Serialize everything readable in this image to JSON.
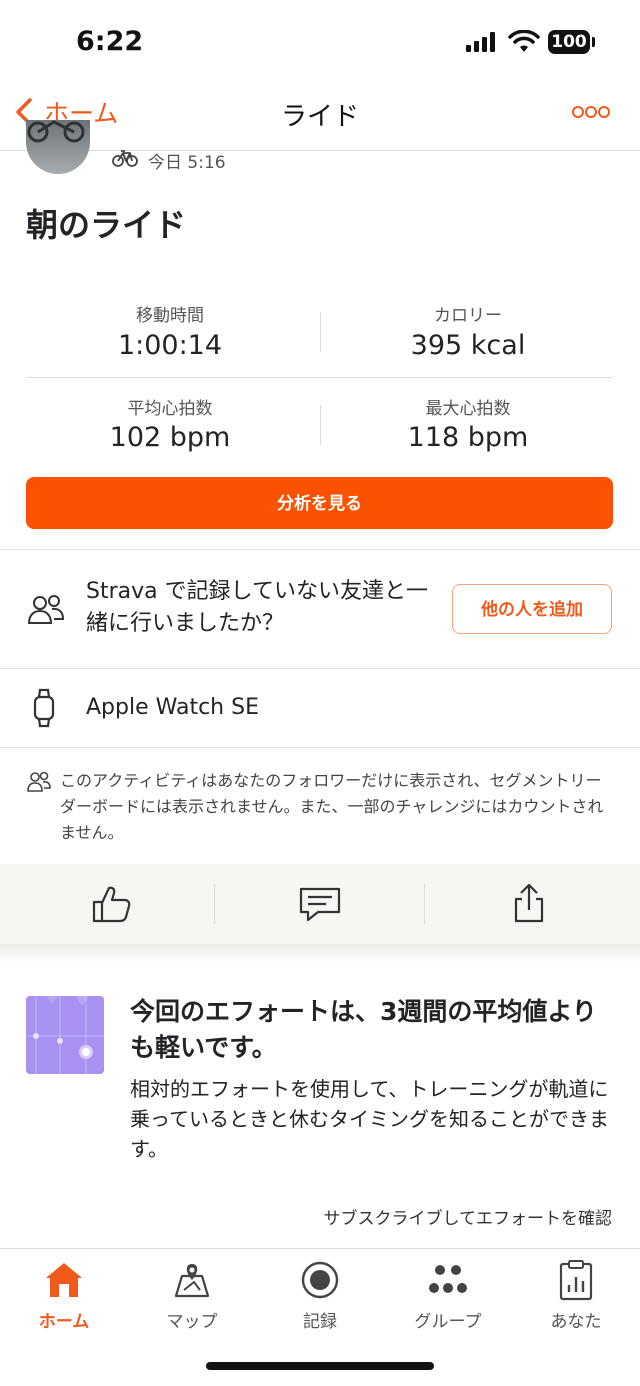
{
  "status_bar": {
    "time": "6:22",
    "battery": "100"
  },
  "nav": {
    "back_label": "ホーム",
    "title": "ライド"
  },
  "activity": {
    "date": "今日 5:16",
    "title": "朝のライド"
  },
  "stats": [
    {
      "label": "移動時間",
      "value": "1:00:14"
    },
    {
      "label": "カロリー",
      "value": "395 kcal"
    },
    {
      "label": "平均心拍数",
      "value": "102 bpm"
    },
    {
      "label": "最大心拍数",
      "value": "118 bpm"
    }
  ],
  "analysis_button": "分析を見る",
  "friends": {
    "text": "Strava で記録していない友達と一緒に行いましたか？",
    "button": "他の人を追加"
  },
  "device": "Apple Watch SE",
  "privacy_note": "このアクティビティはあなたのフォロワーだけに表示され、セグメントリーダーボードには表示されません。また、一部のチャレンジにはカウントされません。",
  "effort": {
    "heading": "今回のエフォートは、3週間の平均値よりも軽いです。",
    "description": "相対的エフォートを使用して、トレーニングが軌道に乗っているときと休むタイミングを知ることができます。",
    "subscribe_link": "サブスクライブしてエフォートを確認"
  },
  "tabs": [
    {
      "label": "ホーム",
      "icon": "home-icon",
      "active": true
    },
    {
      "label": "マップ",
      "icon": "map-icon",
      "active": false
    },
    {
      "label": "記録",
      "icon": "record-icon",
      "active": false
    },
    {
      "label": "グループ",
      "icon": "groups-icon",
      "active": false
    },
    {
      "label": "あなた",
      "icon": "you-icon",
      "active": false
    }
  ],
  "colors": {
    "accent": "#fc5200",
    "effort_graphic": "#b7a6f3"
  }
}
